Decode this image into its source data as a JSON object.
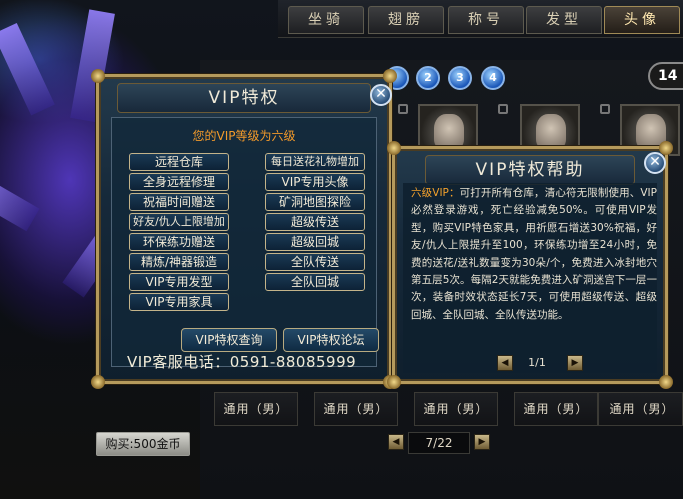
{
  "tabs": [
    {
      "label": "坐骑",
      "active": false
    },
    {
      "label": "翅膀",
      "active": false
    },
    {
      "label": "称号",
      "active": false
    },
    {
      "label": "发型",
      "active": false
    },
    {
      "label": "头像",
      "active": true
    }
  ],
  "level_badge": "14",
  "gem_numbers": [
    "2",
    "3",
    "4"
  ],
  "item_labels": [
    "通用（男）",
    "通用（男）",
    "通用（男）",
    "通用（男）",
    "通用（男）"
  ],
  "pager": {
    "prev": "◀",
    "page": "7/22",
    "next": "▶"
  },
  "buy_button": "购买:500金币",
  "vip_panel": {
    "title": "VIP特权",
    "close": "✕",
    "level_text": "您的VIP等级为六级",
    "left_buttons": [
      "远程仓库",
      "全身远程修理",
      "祝福时间赠送",
      "好友/仇人上限增加",
      "环保练功赠送",
      "精炼/神器锻造",
      "VIP专用发型",
      "VIP专用家具"
    ],
    "right_buttons": [
      "每日送花礼物增加",
      "VIP专用头像",
      "矿洞地图探险",
      "超级传送",
      "超级回城",
      "全队传送",
      "全队回城"
    ],
    "query_button": "VIP特权查询",
    "forum_button": "VIP特权论坛",
    "phone": "VIP客服电话：0591-88085999"
  },
  "help_panel": {
    "title": "VIP特权帮助",
    "close": "✕",
    "highlight": "六级VIP：",
    "body": "可打开所有仓库，清心符无限制使用、VIP必然登录游戏，死亡经验减免50%。可使用VIP发型，购买VIP特色家具，用祈愿石增送30%祝福，好友/仇人上限提升至100，环保练功增至24小时，免费的送花/送礼数量变为30朵/个，免费进入冰封地穴第五层5次。每隔2天就能免费进入矿洞迷宫下一层一次，装备时效状态延长7天，可使用超级传送、超级回城、全队回城、全队传送功能。",
    "page": "1/1",
    "prev": "◀",
    "next": "▶"
  },
  "colors": {
    "gold_border": "#b59a5c",
    "orange_text": "#f39a2a",
    "panel_blue": "#16293a"
  }
}
